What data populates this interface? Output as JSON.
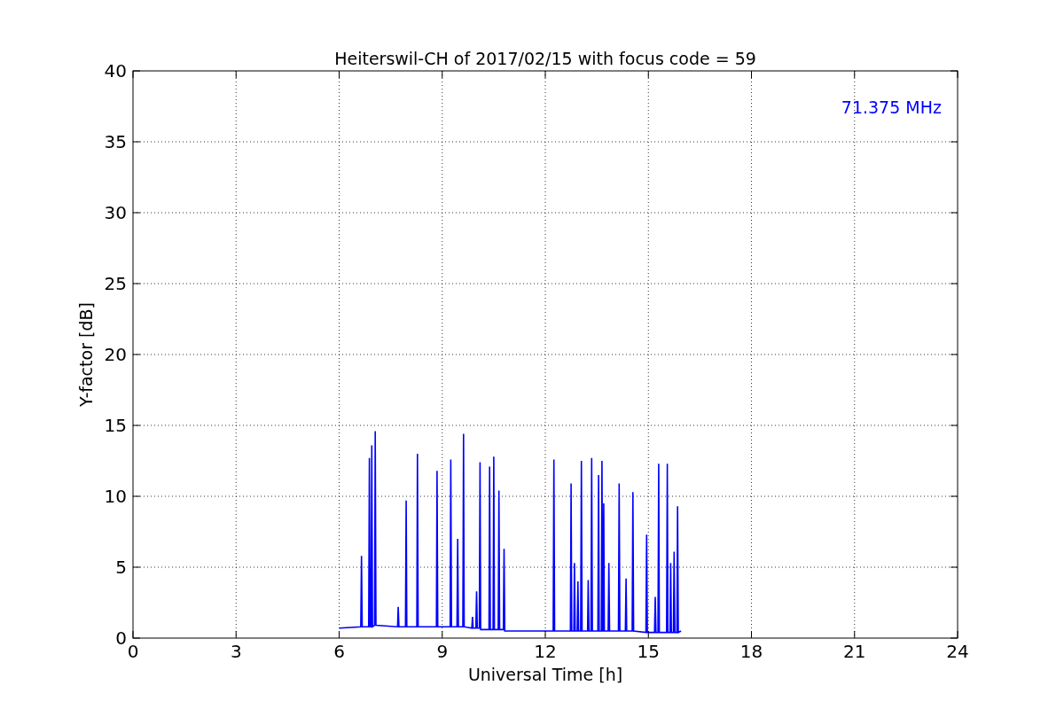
{
  "chart": {
    "chart_data": {
      "type": "line",
      "title": "Heiterswil-CH of 2017/02/15 with focus code = 59",
      "xlabel": "Universal Time [h]",
      "ylabel": "Y-factor [dB]",
      "x": [
        6.0,
        6.63,
        6.65,
        6.67,
        6.86,
        6.88,
        6.9,
        6.93,
        6.95,
        6.97,
        7.03,
        7.05,
        7.07,
        7.7,
        7.72,
        7.74,
        7.93,
        7.95,
        7.97,
        8.26,
        8.28,
        8.3,
        8.83,
        8.85,
        8.87,
        9.23,
        9.25,
        9.27,
        9.43,
        9.45,
        9.47,
        9.6,
        9.62,
        9.64,
        9.86,
        9.88,
        9.9,
        9.98,
        10.0,
        10.02,
        10.08,
        10.1,
        10.12,
        10.36,
        10.38,
        10.4,
        10.48,
        10.5,
        10.52,
        10.63,
        10.65,
        10.67,
        10.78,
        10.8,
        10.82,
        12.23,
        12.25,
        12.27,
        12.73,
        12.75,
        12.77,
        12.83,
        12.85,
        12.87,
        12.93,
        12.95,
        12.97,
        13.03,
        13.05,
        13.07,
        13.23,
        13.25,
        13.27,
        13.33,
        13.35,
        13.37,
        13.53,
        13.55,
        13.57,
        13.63,
        13.65,
        13.67,
        13.68,
        13.7,
        13.72,
        13.83,
        13.85,
        13.87,
        14.13,
        14.15,
        14.17,
        14.33,
        14.35,
        14.37,
        14.53,
        14.55,
        14.57,
        14.93,
        14.95,
        14.97,
        15.18,
        15.2,
        15.22,
        15.28,
        15.3,
        15.32,
        15.53,
        15.55,
        15.57,
        15.63,
        15.65,
        15.67,
        15.73,
        15.75,
        15.77,
        15.83,
        15.85,
        15.87,
        15.95
      ],
      "series": [
        {
          "name": "71.375 MHz",
          "color": "#0000ff",
          "values": [
            0.7,
            0.8,
            5.8,
            0.8,
            0.8,
            12.7,
            0.8,
            0.8,
            13.6,
            0.8,
            0.9,
            14.6,
            0.9,
            0.8,
            2.2,
            0.8,
            0.8,
            9.7,
            0.8,
            0.8,
            13.0,
            0.8,
            0.8,
            11.8,
            0.8,
            0.8,
            12.6,
            0.8,
            0.8,
            7.0,
            0.8,
            0.8,
            14.4,
            0.8,
            0.7,
            1.5,
            0.7,
            0.7,
            3.3,
            0.7,
            0.7,
            12.4,
            0.6,
            0.6,
            12.1,
            0.6,
            0.6,
            12.8,
            0.6,
            0.6,
            10.4,
            0.6,
            0.6,
            6.3,
            0.5,
            0.5,
            12.6,
            0.5,
            0.5,
            10.9,
            0.5,
            0.5,
            5.3,
            0.5,
            0.5,
            4.0,
            0.5,
            0.5,
            12.5,
            0.5,
            0.5,
            4.1,
            0.5,
            0.5,
            12.7,
            0.5,
            0.5,
            11.5,
            0.5,
            0.5,
            12.5,
            0.5,
            0.5,
            9.5,
            0.5,
            0.5,
            5.3,
            0.5,
            0.5,
            10.9,
            0.5,
            0.5,
            4.2,
            0.5,
            0.5,
            10.3,
            0.5,
            0.4,
            7.3,
            0.4,
            0.4,
            2.9,
            0.4,
            0.4,
            12.3,
            0.4,
            0.4,
            12.3,
            0.4,
            0.4,
            5.3,
            0.4,
            0.4,
            6.1,
            0.4,
            0.4,
            9.3,
            0.4,
            0.5
          ]
        }
      ],
      "grid": true,
      "xlim": [
        0,
        24
      ],
      "ylim": [
        0,
        40
      ],
      "xticks": [
        0,
        3,
        6,
        9,
        12,
        15,
        18,
        21,
        24
      ],
      "yticks": [
        0,
        5,
        10,
        15,
        20,
        25,
        30,
        35,
        40
      ]
    }
  }
}
